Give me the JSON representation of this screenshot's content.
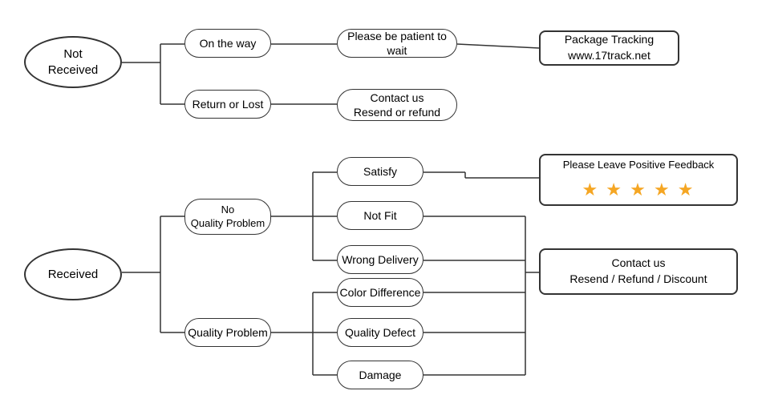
{
  "nodes": {
    "not_received": "Not\nReceived",
    "received": "Received",
    "on_the_way": "On the way",
    "return_or_lost": "Return or Lost",
    "please_wait": "Please be patient to wait",
    "contact_resend_refund": "Contact us\nResend or refund",
    "package_tracking": "Package Tracking\nwww.17track.net",
    "no_quality_problem": "No\nQuality Problem",
    "quality_problem": "Quality Problem",
    "satisfy": "Satisfy",
    "not_fit": "Not Fit",
    "wrong_delivery": "Wrong Delivery",
    "color_difference": "Color Difference",
    "quality_defect": "Quality Defect",
    "damage": "Damage",
    "please_leave_feedback": "Please Leave Positive Feedback",
    "stars": "★ ★ ★ ★ ★",
    "contact_resend_refund_discount": "Contact us\nResend / Refund / Discount"
  }
}
